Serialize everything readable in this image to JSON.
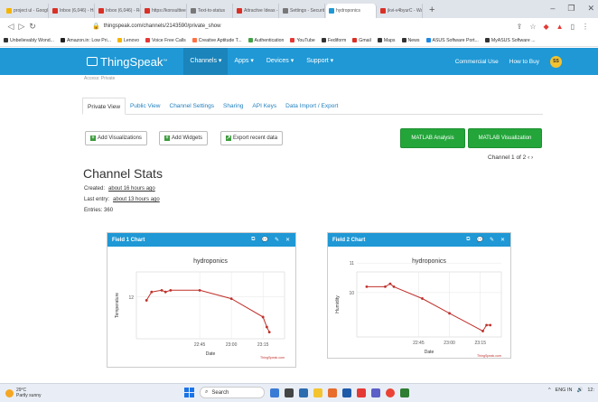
{
  "browser": {
    "tabs": [
      {
        "label": "project ul - Google",
        "color": "#f4b400"
      },
      {
        "label": "Inbox (6,046) - Hac",
        "color": "#d93025"
      },
      {
        "label": "Inbox (6,046) - Rol",
        "color": "#d93025"
      },
      {
        "label": "https://konsultteen",
        "color": "#d93025"
      },
      {
        "label": "Text-to-status",
        "color": "#777777"
      },
      {
        "label": "Attractive Ideas - V",
        "color": "#d93025"
      },
      {
        "label": "Settings - Security",
        "color": "#777777"
      },
      {
        "label": "hydroponics",
        "color": "#1f98d5",
        "active": true
      },
      {
        "label": "jkvi-v4byurC - Wat",
        "color": "#d93025"
      }
    ],
    "new_tab": "+",
    "url": "thingspeak.com/channels/2143590/private_show",
    "window_controls": [
      "–",
      "❐",
      "✕"
    ]
  },
  "bookmarks": [
    {
      "label": "Unbelievably Wond...",
      "color": "#333333"
    },
    {
      "label": "Amazon.in: Low Pri...",
      "color": "#222222"
    },
    {
      "label": "Lenovo",
      "color": "#f4b400"
    },
    {
      "label": "Voice Free Calls",
      "color": "#e53935"
    },
    {
      "label": "Creative Aptitude T...",
      "color": "#ff7043"
    },
    {
      "label": "Authentication",
      "color": "#43a047"
    },
    {
      "label": "YouTube",
      "color": "#e53935"
    },
    {
      "label": "Fediform",
      "color": "#333333"
    },
    {
      "label": "Gmail",
      "color": "#d93025"
    },
    {
      "label": "Maps",
      "color": "#333333"
    },
    {
      "label": "News",
      "color": "#333333"
    },
    {
      "label": "ASUS Software Port...",
      "color": "#1e88e5"
    },
    {
      "label": "MyASUS Software ...",
      "color": "#333333"
    }
  ],
  "thingspeak": {
    "logo": "ThingSpeak",
    "tm": "™",
    "menu": [
      "Channels ▾",
      "Apps ▾",
      "Devices ▾",
      "Support ▾"
    ],
    "commercial_use": "Commercial Use",
    "how_to_buy": "How to Buy",
    "avatar": "SS",
    "cutoff_text": "Access: Private"
  },
  "channel_tabs": [
    "Private View",
    "Public View",
    "Channel Settings",
    "Sharing",
    "API Keys",
    "Data Import / Export"
  ],
  "actions": {
    "add_visualizations": "Add Visualizations",
    "add_widgets": "Add Widgets",
    "export": "Export recent data",
    "matlab_analysis": "MATLAB Analysis",
    "matlab_visualization": "MATLAB Visualization",
    "pager": "Channel 1 of 2  ‹  ›"
  },
  "stats": {
    "title": "Channel Stats",
    "created_label": "Created:",
    "created_value": "about 16 hours ago",
    "last_entry_label": "Last entry:",
    "last_entry_value": "about 13 hours ago",
    "entries_label": "Entries:",
    "entries_value": "360"
  },
  "widgets": [
    {
      "header": "Field 1 Chart",
      "title": "hydroponics",
      "ylabel": "Temperature",
      "xlabel": "Date",
      "credit": "ThingSpeak.com"
    },
    {
      "header": "Field 2 Chart",
      "title": "hydroponics",
      "ylabel": "Humidity",
      "xlabel": "Date",
      "credit": "ThingSpeak.com"
    }
  ],
  "widget_controls": [
    "⧉",
    "💬",
    "✎",
    "✕"
  ],
  "chart_data": [
    {
      "type": "line",
      "title": "hydroponics",
      "xlabel": "Date",
      "ylabel": "Temperature",
      "x_ticks": [
        "22:45",
        "23:00",
        "23:15"
      ],
      "y_ticks": [
        "12"
      ],
      "series": [
        {
          "color": "#c0302b",
          "points": [
            [
              22.33,
              11.8
            ],
            [
              22.37,
              12.3
            ],
            [
              22.45,
              12.4
            ],
            [
              22.48,
              12.3
            ],
            [
              22.52,
              12.4
            ],
            [
              22.75,
              12.4
            ],
            [
              23.0,
              11.9
            ],
            [
              23.25,
              10.8
            ],
            [
              23.28,
              10.2
            ],
            [
              23.3,
              9.9
            ]
          ]
        }
      ],
      "ylim": [
        9.5,
        13.5
      ]
    },
    {
      "type": "line",
      "title": "hydroponics",
      "xlabel": "Date",
      "ylabel": "Humidity",
      "x_ticks": [
        "22:45",
        "23:00",
        "23:15"
      ],
      "y_ticks": [
        "10",
        "11"
      ],
      "series": [
        {
          "color": "#c0302b",
          "points": [
            [
              22.33,
              10.2
            ],
            [
              22.48,
              10.2
            ],
            [
              22.52,
              10.3
            ],
            [
              22.55,
              10.2
            ],
            [
              22.78,
              9.8
            ],
            [
              23.0,
              9.3
            ],
            [
              23.27,
              8.7
            ],
            [
              23.3,
              8.9
            ],
            [
              23.33,
              8.9
            ]
          ]
        }
      ],
      "ylim": [
        8.5,
        10.7
      ]
    }
  ],
  "taskbar": {
    "weather_temp": "29°C",
    "weather_desc": "Partly sunny",
    "search": "Search",
    "tray": [
      "^",
      "ENG IN",
      "🔊",
      "12:"
    ]
  }
}
